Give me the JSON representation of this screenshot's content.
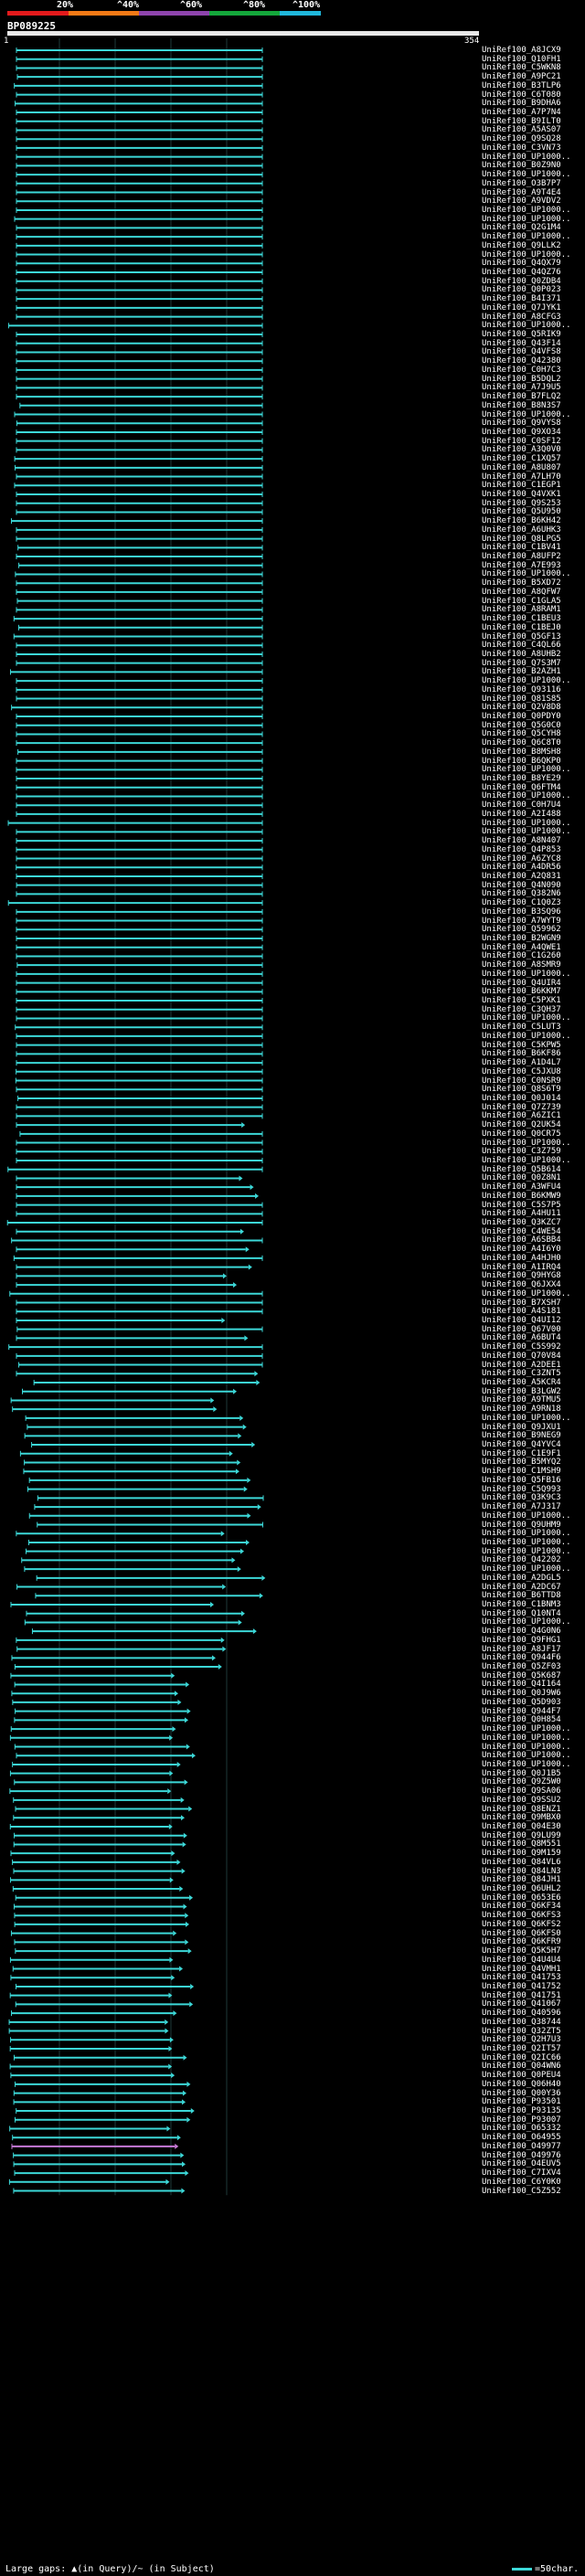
{
  "scale": {
    "labels": [
      "20%",
      "^40%",
      "^60%",
      "^80%",
      "^100%"
    ],
    "colors": [
      "#e31a1c",
      "#f47a16",
      "#8e44ad",
      "#14a83b",
      "#20b8dc"
    ]
  },
  "query": {
    "name": "BP089225",
    "start": "1",
    "end": "354"
  },
  "colors": {
    "hit": "#3cd8d8",
    "hit_alt": "#c87ad8",
    "gap_subject": "#1a6a6a",
    "gridline": "#1e3a3a",
    "label": "#ffffff"
  },
  "hits": [
    "UniRef100_A8JCX9",
    "UniRef100_Q10FH1",
    "UniRef100_C5WKN8",
    "UniRef100_A9PC21",
    "UniRef100_B3TLP6",
    "UniRef100_C6T080",
    "UniRef100_B9DHA6",
    "UniRef100_A7P7N4",
    "UniRef100_B9ILT0",
    "UniRef100_A5AS07",
    "UniRef100_Q9SQ28",
    "UniRef100_C3VN73",
    "UniRef100_UP1000..",
    "UniRef100_B0Z9N0",
    "UniRef100_UP1000..",
    "UniRef100_O3B7P7",
    "UniRef100_A9T4E4",
    "UniRef100_A9VDV2",
    "UniRef100_UP1000..",
    "UniRef100_UP1000..",
    "UniRef100_Q2G1M4",
    "UniRef100_UP1000..",
    "UniRef100_Q9LLK2",
    "UniRef100_UP1000..",
    "UniRef100_Q4QX79",
    "UniRef100_Q4QZ76",
    "UniRef100_Q0ZDB4",
    "UniRef100_Q0P023",
    "UniRef100_B4I371",
    "UniRef100_Q7JYK1",
    "UniRef100_A8CFG3",
    "UniRef100_UP1000..",
    "UniRef100_Q5RIK9",
    "UniRef100_Q43F14",
    "UniRef100_Q4VFS8",
    "UniRef100_Q42380",
    "UniRef100_C0H7C3",
    "UniRef100_B5DQL2",
    "UniRef100_A7J9U5",
    "UniRef100_B7FLQ2",
    "UniRef100_B8N3S7",
    "UniRef100_UP1000..",
    "UniRef100_Q9VYS8",
    "UniRef100_Q9XO34",
    "UniRef100_C0SF12",
    "UniRef100_A3Q0V0",
    "UniRef100_C1XQ57",
    "UniRef100_A8U807",
    "UniRef100_A7LH70",
    "UniRef100_C1EGP1",
    "UniRef100_Q4VXK1",
    "UniRef100_Q9S253",
    "UniRef100_Q5U950",
    "UniRef100_B6KH42",
    "UniRef100_A6UHK3",
    "UniRef100_Q8LPG5",
    "UniRef100_C1BV41",
    "UniRef100_A8UFP2",
    "UniRef100_A7E993",
    "UniRef100_UP1000..",
    "UniRef100_B5XD72",
    "UniRef100_A8QFW7",
    "UniRef100_C1GLA5",
    "UniRef100_A8RAM1",
    "UniRef100_C1BEU3",
    "UniRef100_C1BEJ0",
    "UniRef100_Q5GF13",
    "UniRef100_C4QL66",
    "UniRef100_A8UHB2",
    "UniRef100_Q7S3M7",
    "UniRef100_B2AZH1",
    "UniRef100_UP1000..",
    "UniRef100_Q93116",
    "UniRef100_Q81S85",
    "UniRef100_Q2V8D8",
    "UniRef100_Q0PDY0",
    "UniRef100_Q5G0C0",
    "UniRef100_Q5CYH8",
    "UniRef100_Q6C8T0",
    "UniRef100_B8MSH8",
    "UniRef100_B6QKP0",
    "UniRef100_UP1000..",
    "UniRef100_B8YE29",
    "UniRef100_Q6FTM4",
    "UniRef100_UP1000..",
    "UniRef100_C0H7U4",
    "UniRef100_A2I488",
    "UniRef100_UP1000..",
    "UniRef100_UP1000..",
    "UniRef100_A8N407",
    "UniRef100_Q4P853",
    "UniRef100_A6ZYC8",
    "UniRef100_A4DR56",
    "UniRef100_A2Q831",
    "UniRef100_Q4N090",
    "UniRef100_Q382N6",
    "UniRef100_C1Q0Z3",
    "UniRef100_B3SQ96",
    "UniRef100_A7WYT9",
    "UniRef100_Q59962",
    "UniRef100_B2WGN9",
    "UniRef100_A4QWE1",
    "UniRef100_C1G260",
    "UniRef100_A8SMR9",
    "UniRef100_UP1000..",
    "UniRef100_Q4UIR4",
    "UniRef100_B6KKM7",
    "UniRef100_C5PXK1",
    "UniRef100_C3QH37",
    "UniRef100_UP1000..",
    "UniRef100_C5LUT3",
    "UniRef100_UP1000..",
    "UniRef100_C5KPW5",
    "UniRef100_B6KF86",
    "UniRef100_A1D4L7",
    "UniRef100_C5JXU8",
    "UniRef100_C0NSR9",
    "UniRef100_Q8S6T9",
    "UniRef100_Q0J014",
    "UniRef100_Q7Z739",
    "UniRef100_A6ZIC1",
    "UniRef100_Q2UK54",
    "UniRef100_Q0CR75",
    "UniRef100_UP1000..",
    "UniRef100_C3Z759",
    "UniRef100_UP1000..",
    "UniRef100_Q5B614",
    "UniRef100_Q0Z8N1",
    "UniRef100_A3WFU4",
    "UniRef100_B6KMW9",
    "UniRef100_C5S7P5",
    "UniRef100_A4HU11",
    "UniRef100_Q3KZC7",
    "UniRef100_C4WE54",
    "UniRef100_A6SBB4",
    "UniRef100_A4I6Y0",
    "UniRef100_A4HJH0",
    "UniRef100_A1IRQ4",
    "UniRef100_Q9HYG8",
    "UniRef100_Q6JXX4",
    "UniRef100_UP1000..",
    "UniRef100_B7XSH7",
    "UniRef100_A4S181",
    "UniRef100_Q4UI12",
    "UniRef100_Q67V00",
    "UniRef100_A6BUT4",
    "UniRef100_C5S992",
    "UniRef100_Q70V84",
    "UniRef100_A2DEE1",
    "UniRef100_C3ZNT5",
    "UniRef100_A5KCR4",
    "UniRef100_B3LGW2",
    "UniRef100_A9TMU5",
    "UniRef100_A9RN18",
    "UniRef100_UP1000..",
    "UniRef100_Q9JXU1",
    "UniRef100_B9NEG9",
    "UniRef100_Q4YVC4",
    "UniRef100_C1E9F1",
    "UniRef100_B5MYQ2",
    "UniRef100_C1MSH9",
    "UniRef100_Q5FB16",
    "UniRef100_C5Q993",
    "UniRef100_Q3K9C3",
    "UniRef100_A7J317",
    "UniRef100_UP1000..",
    "UniRef100_Q9UHM9",
    "UniRef100_UP1000..",
    "UniRef100_UP1000..",
    "UniRef100_UP1000..",
    "UniRef100_Q42202",
    "UniRef100_UP1000..",
    "UniRef100_A2DGL5",
    "UniRef100_A2DC67",
    "UniRef100_B6TTD8",
    "UniRef100_C1BNM3",
    "UniRef100_Q10NT4",
    "UniRef100_UP1000..",
    "UniRef100_Q4G0N6",
    "UniRef100_Q9FHG1",
    "UniRef100_A8JF17",
    "UniRef100_Q944F6",
    "UniRef100_Q5ZF03",
    "UniRef100_Q5K687",
    "UniRef100_Q4I164",
    "UniRef100_Q0J9W6",
    "UniRef100_Q5D903",
    "UniRef100_Q944F7",
    "UniRef100_Q0H854",
    "UniRef100_UP1000..",
    "UniRef100_UP1000..",
    "UniRef100_UP1000..",
    "UniRef100_UP1000..",
    "UniRef100_UP1000..",
    "UniRef100_Q0J1B5",
    "UniRef100_Q9Z5W0",
    "UniRef100_Q9SA06",
    "UniRef100_Q9SSU2",
    "UniRef100_Q8ENZ1",
    "UniRef100_Q9MBX0",
    "UniRef100_Q04E30",
    "UniRef100_Q9LU99",
    "UniRef100_Q8M551",
    "UniRef100_Q9M159",
    "UniRef100_Q84VL6",
    "UniRef100_Q84LN3",
    "UniRef100_Q84JH1",
    "UniRef100_Q6UHL2",
    "UniRef100_Q653E6",
    "UniRef100_Q6KF34",
    "UniRef100_Q6KFS3",
    "UniRef100_Q6KFS2",
    "UniRef100_Q6KFS0",
    "UniRef100_Q6KFR9",
    "UniRef100_Q5K5H7",
    "UniRef100_Q4U4U4",
    "UniRef100_Q4VMH1",
    "UniRef100_Q41753",
    "UniRef100_Q41752",
    "UniRef100_Q41751",
    "UniRef100_Q41067",
    "UniRef100_Q40596",
    "UniRef100_Q38744",
    "UniRef100_Q32ZT5",
    "UniRef100_Q2H7U3",
    "UniRef100_Q2IT57",
    "UniRef100_Q2IC66",
    "UniRef100_Q04WN6",
    "UniRef100_Q0PEU4",
    "UniRef100_Q06H40",
    "UniRef100_Q00Y36",
    "UniRef100_P93501",
    "UniRef100_P93135",
    "UniRef100_P93007",
    "UniRef100_O65332",
    "UniRef100_O64955",
    "UniRef100_O49977",
    "UniRef100_O49976",
    "UniRef100_O4EUV5",
    "UniRef100_C7IXV4",
    "UniRef100_C6Y0K0",
    "UniRef100_C5Z552"
  ],
  "legend": {
    "gaps_text": "Large gaps: ▲(in Query)/~ (in Subject)",
    "key_text": "=50char."
  }
}
